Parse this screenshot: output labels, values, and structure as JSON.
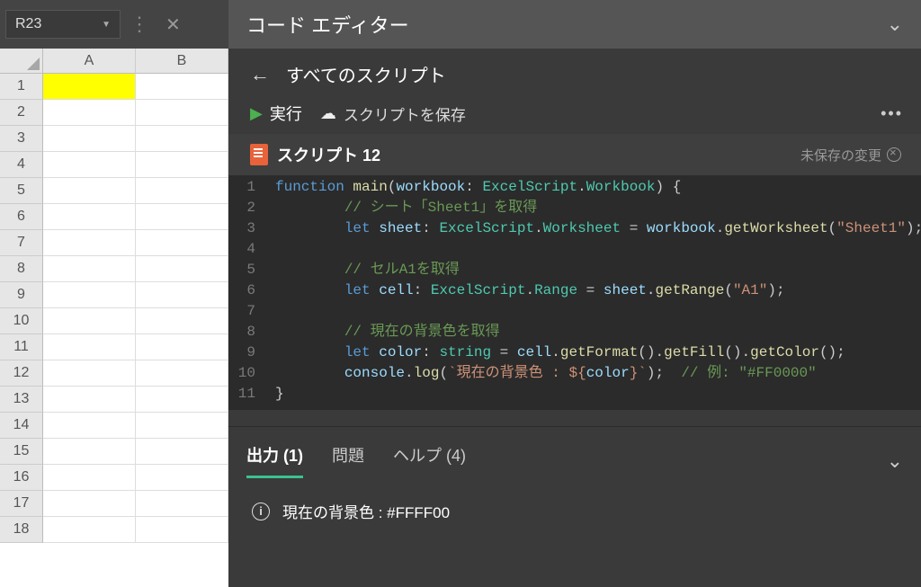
{
  "namebox": {
    "value": "R23"
  },
  "editor": {
    "title": "コード エディター",
    "back_label": "すべてのスクリプト",
    "run_label": "実行",
    "save_label": "スクリプトを保存",
    "script_name": "スクリプト 12",
    "unsaved_label": "未保存の変更"
  },
  "sheet": {
    "columns": [
      "A",
      "B"
    ],
    "rows": [
      1,
      2,
      3,
      4,
      5,
      6,
      7,
      8,
      9,
      10,
      11,
      12,
      13,
      14,
      15,
      16,
      17,
      18
    ],
    "highlight_cell": "A1"
  },
  "code": {
    "lines": [
      {
        "n": 1,
        "tokens": [
          [
            "tk-keyword",
            "function "
          ],
          [
            "tk-func",
            "main"
          ],
          [
            "tk-punc",
            "("
          ],
          [
            "tk-var",
            "workbook"
          ],
          [
            "tk-punc",
            ": "
          ],
          [
            "tk-type",
            "ExcelScript"
          ],
          [
            "tk-punc",
            "."
          ],
          [
            "tk-type",
            "Workbook"
          ],
          [
            "tk-punc",
            ") {"
          ]
        ]
      },
      {
        "n": 2,
        "indent": 2,
        "tokens": [
          [
            "tk-comment",
            "// シート「Sheet1」を取得"
          ]
        ]
      },
      {
        "n": 3,
        "indent": 2,
        "tokens": [
          [
            "tk-keyword",
            "let "
          ],
          [
            "tk-var",
            "sheet"
          ],
          [
            "tk-punc",
            ": "
          ],
          [
            "tk-type",
            "ExcelScript"
          ],
          [
            "tk-punc",
            "."
          ],
          [
            "tk-type",
            "Worksheet"
          ],
          [
            "tk-punc",
            " = "
          ],
          [
            "tk-var",
            "workbook"
          ],
          [
            "tk-punc",
            "."
          ],
          [
            "tk-func",
            "getWorksheet"
          ],
          [
            "tk-punc",
            "("
          ],
          [
            "tk-string",
            "\"Sheet1\""
          ],
          [
            "tk-punc",
            ");"
          ]
        ]
      },
      {
        "n": 4,
        "indent": 2,
        "tokens": []
      },
      {
        "n": 5,
        "indent": 2,
        "tokens": [
          [
            "tk-comment",
            "// セルA1を取得"
          ]
        ]
      },
      {
        "n": 6,
        "indent": 2,
        "tokens": [
          [
            "tk-keyword",
            "let "
          ],
          [
            "tk-var",
            "cell"
          ],
          [
            "tk-punc",
            ": "
          ],
          [
            "tk-type",
            "ExcelScript"
          ],
          [
            "tk-punc",
            "."
          ],
          [
            "tk-type",
            "Range"
          ],
          [
            "tk-punc",
            " = "
          ],
          [
            "tk-var",
            "sheet"
          ],
          [
            "tk-punc",
            "."
          ],
          [
            "tk-func",
            "getRange"
          ],
          [
            "tk-punc",
            "("
          ],
          [
            "tk-string",
            "\"A1\""
          ],
          [
            "tk-punc",
            ");"
          ]
        ]
      },
      {
        "n": 7,
        "indent": 2,
        "tokens": []
      },
      {
        "n": 8,
        "indent": 2,
        "tokens": [
          [
            "tk-comment",
            "// 現在の背景色を取得"
          ]
        ]
      },
      {
        "n": 9,
        "indent": 2,
        "tokens": [
          [
            "tk-keyword",
            "let "
          ],
          [
            "tk-var",
            "color"
          ],
          [
            "tk-punc",
            ": "
          ],
          [
            "tk-type",
            "string"
          ],
          [
            "tk-punc",
            " = "
          ],
          [
            "tk-var",
            "cell"
          ],
          [
            "tk-punc",
            "."
          ],
          [
            "tk-func",
            "getFormat"
          ],
          [
            "tk-punc",
            "()."
          ],
          [
            "tk-func",
            "getFill"
          ],
          [
            "tk-punc",
            "()."
          ],
          [
            "tk-func",
            "getColor"
          ],
          [
            "tk-punc",
            "();"
          ]
        ]
      },
      {
        "n": 10,
        "indent": 2,
        "tokens": [
          [
            "tk-var",
            "console"
          ],
          [
            "tk-punc",
            "."
          ],
          [
            "tk-func",
            "log"
          ],
          [
            "tk-punc",
            "("
          ],
          [
            "tk-string",
            "`現在の背景色 : ${"
          ],
          [
            "tk-var",
            "color"
          ],
          [
            "tk-string",
            "}`"
          ],
          [
            "tk-punc",
            ");  "
          ],
          [
            "tk-comment",
            "// 例: \"#FF0000\""
          ]
        ]
      },
      {
        "n": 11,
        "indent": 0,
        "tokens": [
          [
            "tk-punc",
            "}"
          ]
        ]
      }
    ]
  },
  "output": {
    "tabs": {
      "output": "出力 (1)",
      "problems": "問題",
      "help": "ヘルプ (4)"
    },
    "message": "現在の背景色 : #FFFF00"
  }
}
